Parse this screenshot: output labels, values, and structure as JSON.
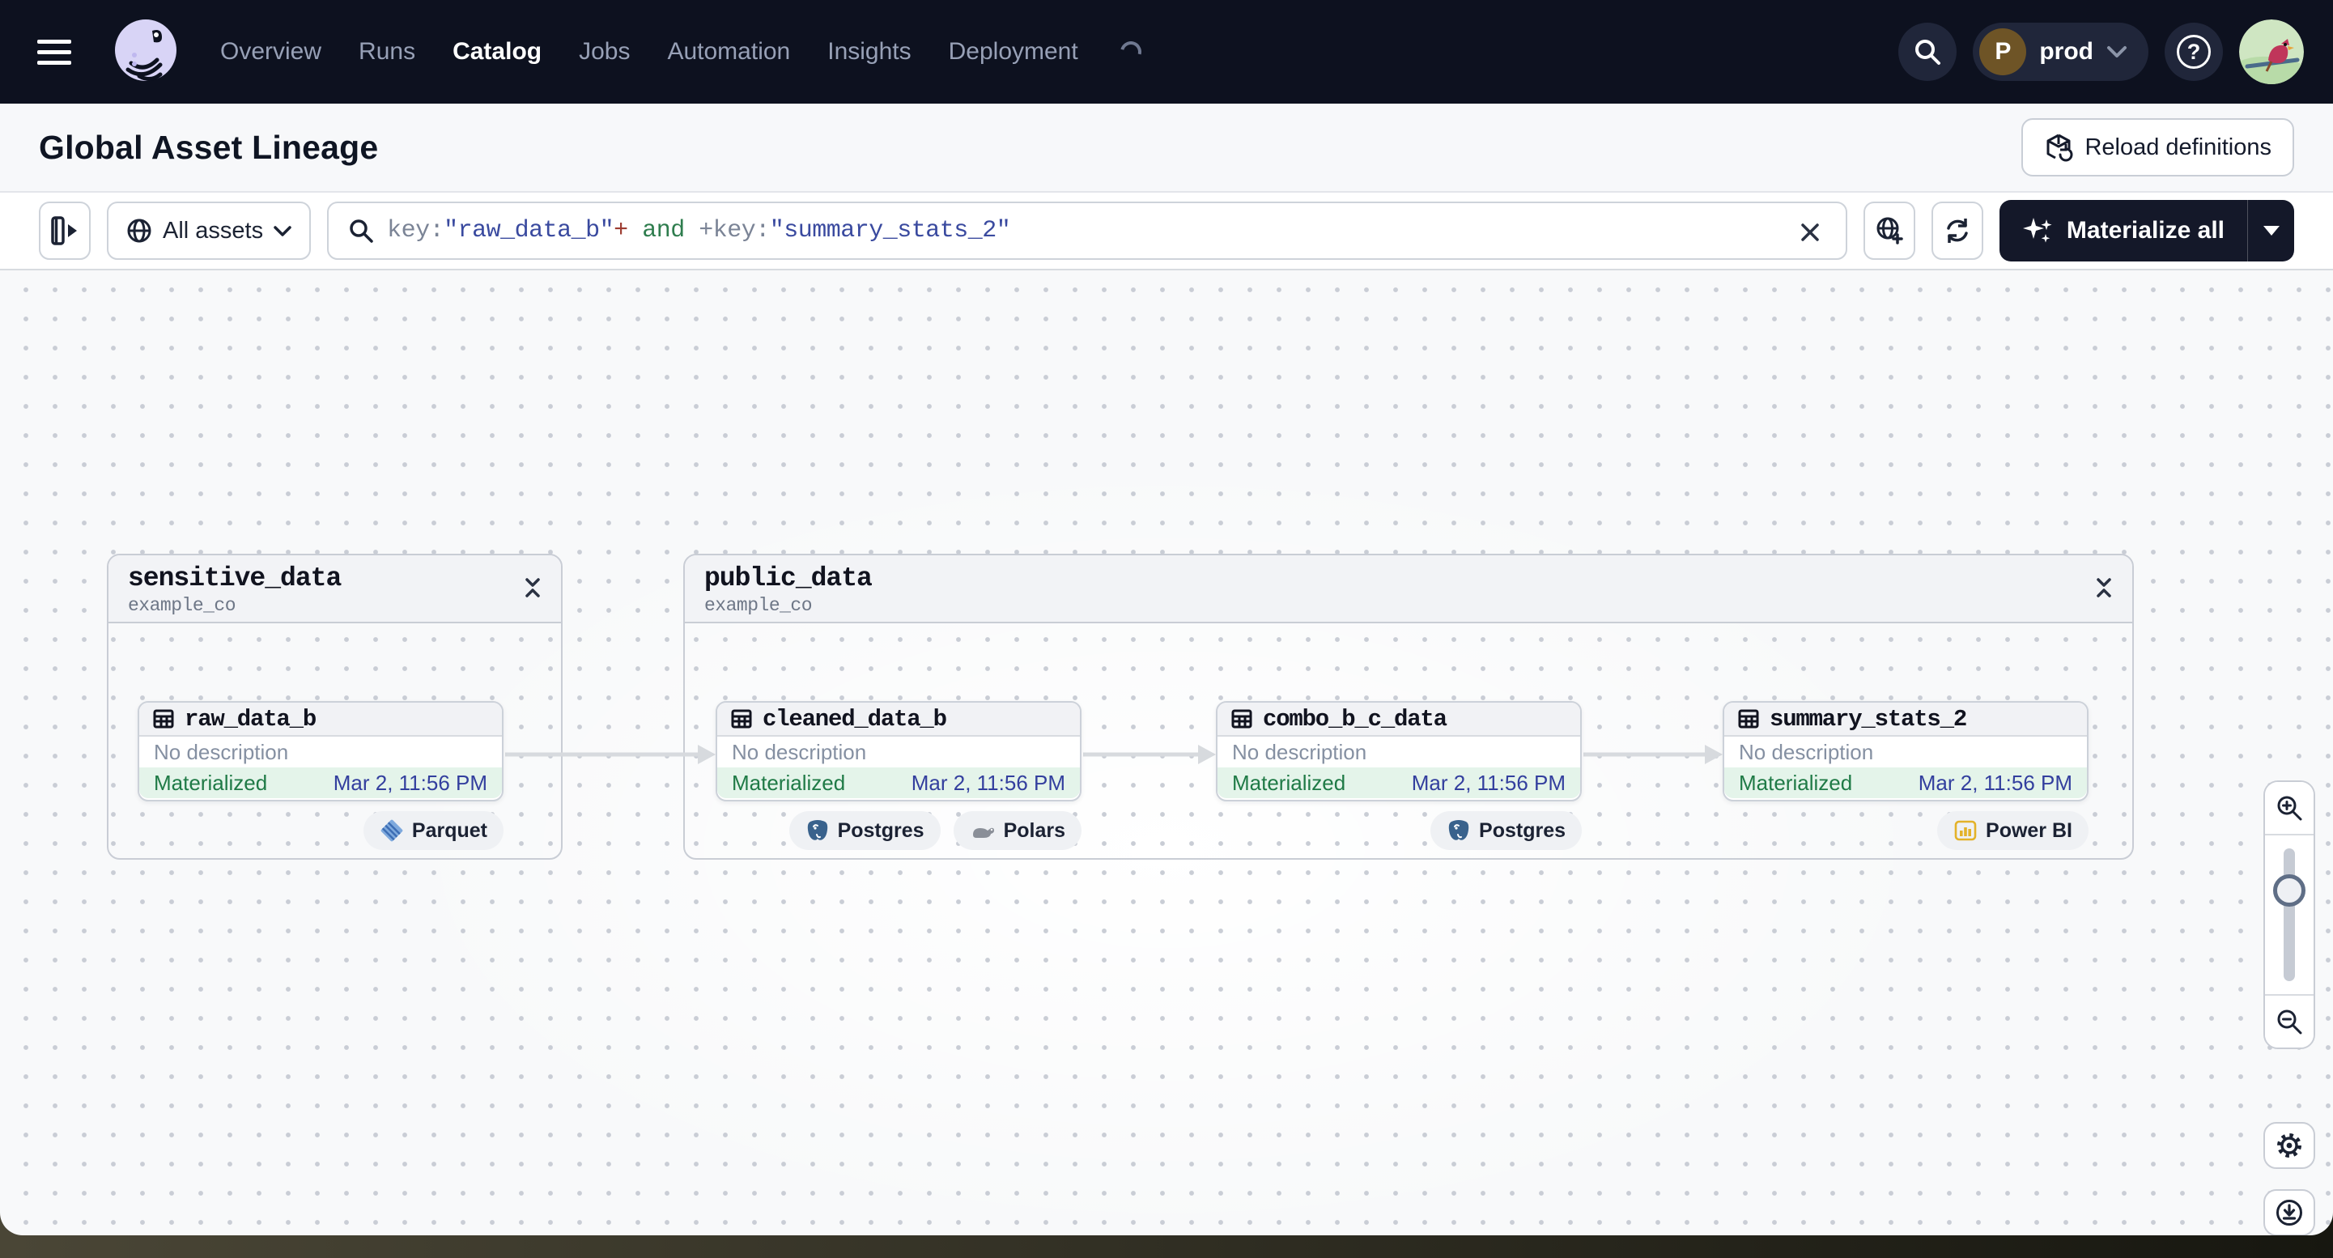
{
  "topnav": {
    "items": [
      {
        "label": "Overview"
      },
      {
        "label": "Runs"
      },
      {
        "label": "Catalog"
      },
      {
        "label": "Jobs"
      },
      {
        "label": "Automation"
      },
      {
        "label": "Insights"
      },
      {
        "label": "Deployment"
      }
    ],
    "active_item": "Catalog",
    "environment": {
      "initial": "P",
      "name": "prod"
    },
    "help_glyph": "?"
  },
  "header": {
    "title": "Global Asset Lineage",
    "reload_button": "Reload definitions"
  },
  "toolbar": {
    "scope_button": "All assets",
    "query": {
      "plain": "key:\"raw_data_b\"+ and +key:\"summary_stats_2\"",
      "segments": [
        {
          "text": "key:",
          "style": "field"
        },
        {
          "text": "\"raw_data_b\"",
          "style": "value"
        },
        {
          "text": "+",
          "style": "operator"
        },
        {
          "text": " and ",
          "style": "keyword"
        },
        {
          "text": "+",
          "style": "field"
        },
        {
          "text": "key:",
          "style": "field"
        },
        {
          "text": "\"summary_stats_2\"",
          "style": "value"
        }
      ]
    },
    "materialize_button": "Materialize all"
  },
  "colors": {
    "topnav_bg": "#0d111f",
    "dark_button_bg": "#141829",
    "status_green": "#1f7a46",
    "status_green_bg": "#e4f4ea",
    "timestamp_indigo": "#333f9e",
    "query_field": "#7b8496",
    "query_value": "#3a4a9f",
    "query_operator": "#9d3b31",
    "query_keyword": "#2f7d4e",
    "edge_gray": "#d7dade"
  },
  "graph": {
    "groups": [
      {
        "name": "sensitive_data",
        "location": "example_co",
        "nodes": [
          {
            "name": "raw_data_b",
            "description": "No description",
            "status": "Materialized",
            "timestamp": "Mar 2, 11:56 PM",
            "tags": [
              "Parquet"
            ]
          }
        ]
      },
      {
        "name": "public_data",
        "location": "example_co",
        "nodes": [
          {
            "name": "cleaned_data_b",
            "description": "No description",
            "status": "Materialized",
            "timestamp": "Mar 2, 11:56 PM",
            "tags": [
              "Postgres",
              "Polars"
            ]
          },
          {
            "name": "combo_b_c_data",
            "description": "No description",
            "status": "Materialized",
            "timestamp": "Mar 2, 11:56 PM",
            "tags": [
              "Postgres"
            ]
          },
          {
            "name": "summary_stats_2",
            "description": "No description",
            "status": "Materialized",
            "timestamp": "Mar 2, 11:56 PM",
            "tags": [
              "Power BI"
            ]
          }
        ]
      }
    ]
  }
}
